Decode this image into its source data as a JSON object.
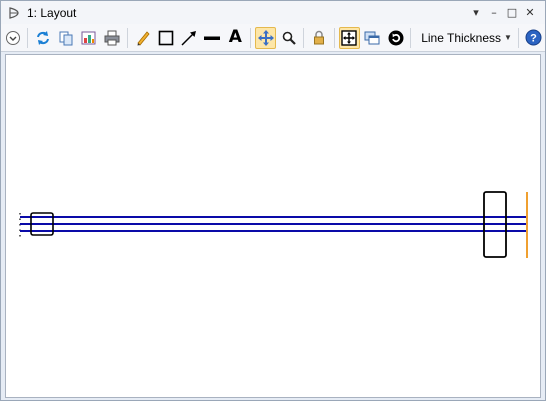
{
  "window": {
    "title": "1: Layout"
  },
  "title_controls": {
    "pin": "▾",
    "minimize": "–",
    "maximize": "□",
    "close": "✕"
  },
  "toolbar": {
    "line_thickness_label": "Line Thickness",
    "text_tool_glyph": "A",
    "active_tool": "pan-move-icon",
    "items": [
      "settings-dropdown-icon",
      "refresh-icon",
      "copy-icon",
      "export-image-icon",
      "print-icon",
      "pencil-icon",
      "rectangle-icon",
      "arrow-icon",
      "line-icon",
      "text-icon",
      "pan-move-icon",
      "zoom-icon",
      "lock-icon",
      "fit-to-window-icon",
      "window-layout-icon",
      "reset-icon",
      "help-icon"
    ]
  },
  "colors": {
    "beam": "#0a0aa8",
    "detector": "#f0a030",
    "outline": "#000000",
    "highlight": "#fde6a8"
  }
}
